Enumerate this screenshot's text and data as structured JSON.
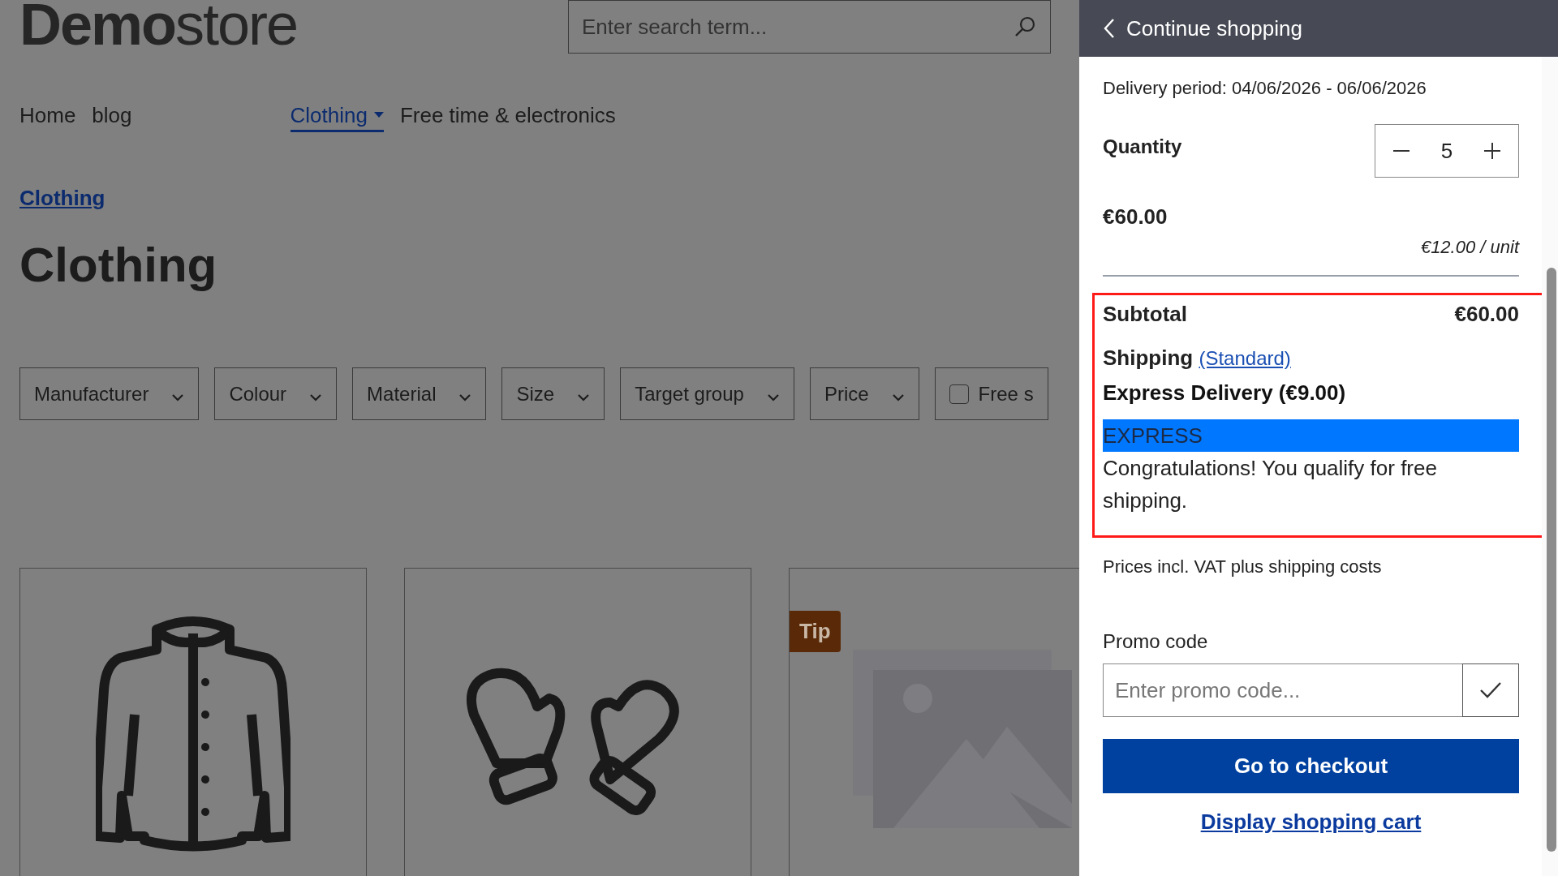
{
  "header": {
    "logo": {
      "bold": "Demo",
      "light": "store"
    },
    "search": {
      "placeholder": "Enter search term..."
    }
  },
  "nav": [
    {
      "label": "Home",
      "selected": false,
      "dropdown": false
    },
    {
      "label": "blog",
      "selected": false,
      "dropdown": false
    },
    {
      "label": "Clothing",
      "selected": true,
      "dropdown": true
    },
    {
      "label": "Free time & electronics",
      "selected": false,
      "dropdown": false
    }
  ],
  "breadcrumb": [
    "Clothing"
  ],
  "page_title": "Clothing",
  "filters": [
    {
      "label": "Manufacturer",
      "kind": "dropdown"
    },
    {
      "label": "Colour",
      "kind": "dropdown"
    },
    {
      "label": "Material",
      "kind": "dropdown"
    },
    {
      "label": "Size",
      "kind": "dropdown"
    },
    {
      "label": "Target group",
      "kind": "dropdown"
    },
    {
      "label": "Price",
      "kind": "dropdown"
    },
    {
      "label": "Free s",
      "kind": "checkbox",
      "checked": false
    }
  ],
  "products": [
    {
      "kind": "jacket"
    },
    {
      "kind": "mittens"
    },
    {
      "kind": "placeholder",
      "badge": "Tip"
    }
  ],
  "cart_drawer": {
    "back_label": "Continue shopping",
    "delivery_period": "Delivery period: 04/06/2026 - 06/06/2026",
    "quantity_label": "Quantity",
    "quantity": "5",
    "line_total": "€60.00",
    "unit_price": "€12.00 / unit",
    "summary": {
      "highlighted": true,
      "subtotal_label": "Subtotal",
      "subtotal": "€60.00",
      "shipping_label": "Shipping",
      "shipping_method": "(Standard)",
      "shipping_option": "Express Delivery (€9.00)",
      "express": {
        "label": "EXPRESS",
        "selected": true
      },
      "message": "Congratulations! You qualify for free shipping."
    },
    "tax_note": "Prices incl. VAT plus shipping costs",
    "promo": {
      "label": "Promo code",
      "placeholder": "Enter promo code..."
    },
    "checkout_button": "Go to checkout",
    "cart_link": "Display shopping cart"
  }
}
